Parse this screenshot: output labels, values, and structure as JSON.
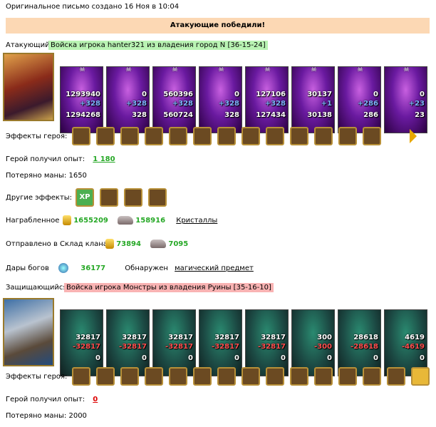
{
  "header": {
    "created": "Оригинальное письмо создано 16 Ноя в 10:04"
  },
  "banner": {
    "result": "Атакующие победили!"
  },
  "attacker": {
    "label": "Атакующий",
    "army": "Войска игрока hanter321 из владения город N [36-15-24]",
    "units": [
      {
        "before": "1293940",
        "delta": "+328",
        "after": "1294268"
      },
      {
        "before": "0",
        "delta": "+328",
        "after": "328"
      },
      {
        "before": "560396",
        "delta": "+328",
        "after": "560724"
      },
      {
        "before": "0",
        "delta": "+328",
        "after": "328"
      },
      {
        "before": "127106",
        "delta": "+328",
        "after": "127434"
      },
      {
        "before": "30137",
        "delta": "+1",
        "after": "30138"
      },
      {
        "before": "0",
        "delta": "+286",
        "after": "286"
      },
      {
        "before": "0",
        "delta": "+23",
        "after": "23"
      }
    ],
    "effects_label": "Эффекты героя:",
    "effects": [
      "mushroom-icon",
      "chest-icon",
      "heart-icon",
      "shield-icon",
      "star-icon",
      "knight-icon",
      "potion-icon",
      "bone-icon",
      "web-icon",
      "fire-icon",
      "snake-icon",
      "boot-icon",
      "bottle-icon"
    ],
    "exp_label": "Герой получил опыт:",
    "exp_value": "1 180",
    "mana_label": "Потеряно маны: 1650",
    "other_label": "Другие эффекты:",
    "other_effects": [
      "xp-icon",
      "sword-icon",
      "bear-icon",
      "blade-icon"
    ],
    "other_xp": "XP",
    "loot_label": "Награбленное",
    "loot_gold": "1655209",
    "loot_crystals": "158916",
    "loot_crystals_label": "Кристаллы",
    "clan_label": "Отправлено в Склад клана",
    "clan_gold": "73894",
    "clan_crystals": "7095",
    "gods_label": "Дары богов",
    "gods_value": "36177",
    "found_label": "Обнаружен",
    "found_item": "магический предмет"
  },
  "defender": {
    "label": "Защищающийся",
    "army": "Войска игрока Монстры из владения Руины [35-16-10]",
    "units": [
      {
        "before": "32817",
        "delta": "-32817",
        "after": "0"
      },
      {
        "before": "32817",
        "delta": "-32817",
        "after": "0"
      },
      {
        "before": "32817",
        "delta": "-32817",
        "after": "0"
      },
      {
        "before": "32817",
        "delta": "-32817",
        "after": "0"
      },
      {
        "before": "32817",
        "delta": "-32817",
        "after": "0"
      },
      {
        "before": "300",
        "delta": "-300",
        "after": "0"
      },
      {
        "before": "28618",
        "delta": "-28618",
        "after": "0"
      },
      {
        "before": "4619",
        "delta": "-4619",
        "after": "0"
      }
    ],
    "effects_label": "Эффекты героя:",
    "effects": [
      "helmet-icon",
      "sword-icon",
      "shield-icon",
      "warrior-icon",
      "armor-icon",
      "hammer-icon",
      "demon-icon",
      "gear-icon",
      "frost-icon",
      "frost-icon",
      "frost-icon",
      "frost-icon",
      "staff-icon",
      "frost-icon",
      "sun-icon"
    ],
    "exp_label": "Герой получил опыт:",
    "exp_value": "0",
    "mana_label": "Потеряно маны: 2000"
  }
}
